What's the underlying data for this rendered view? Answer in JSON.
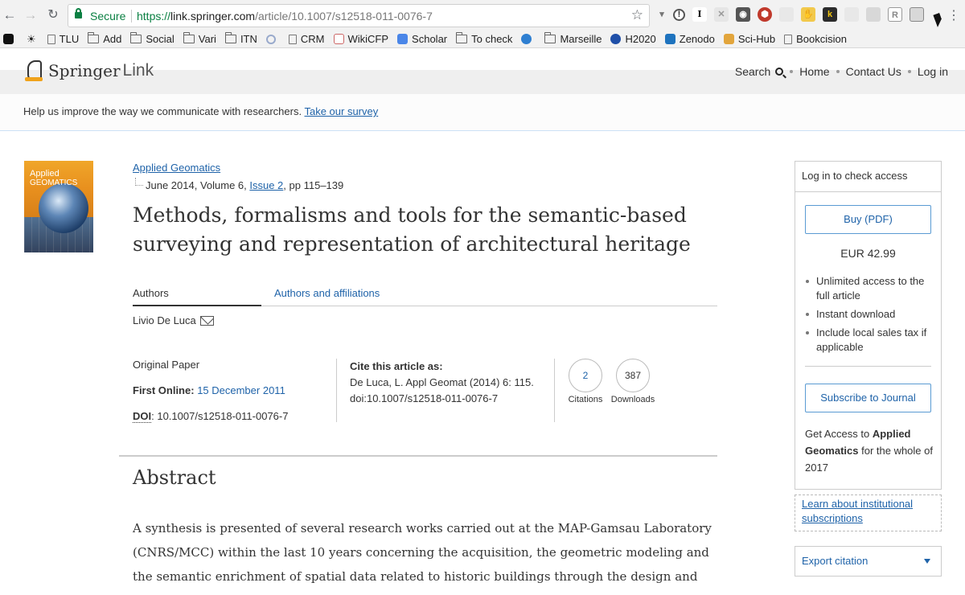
{
  "browser": {
    "secure_label": "Secure",
    "url_scheme": "https://",
    "url_host": "link.springer.com",
    "url_path": "/article/10.1007/s12518-011-0076-7",
    "bookmarks": [
      {
        "label": "TLU",
        "type": "page"
      },
      {
        "label": "Add",
        "type": "folder"
      },
      {
        "label": "Social",
        "type": "folder"
      },
      {
        "label": "Vari",
        "type": "folder"
      },
      {
        "label": "ITN",
        "type": "folder"
      },
      {
        "label": "",
        "type": "loading"
      },
      {
        "label": "CRM",
        "type": "page"
      },
      {
        "label": "WikiCFP",
        "type": "favicon"
      },
      {
        "label": "Scholar",
        "type": "favicon"
      },
      {
        "label": "To check",
        "type": "folder"
      },
      {
        "label": "",
        "type": "favicon"
      },
      {
        "label": "Marseille",
        "type": "folder"
      },
      {
        "label": "H2020",
        "type": "favicon"
      },
      {
        "label": "Zenodo",
        "type": "favicon"
      },
      {
        "label": "Sci-Hub",
        "type": "favicon"
      },
      {
        "label": "Bookcision",
        "type": "page"
      }
    ]
  },
  "header": {
    "logo_springer": "Springer",
    "logo_link": "Link",
    "search_label": "Search",
    "home_label": "Home",
    "contact_label": "Contact Us",
    "login_label": "Log in"
  },
  "survey": {
    "text": "Help us improve the way we communicate with researchers.",
    "link_label": "Take our survey"
  },
  "cover": {
    "title_line1": "Applied",
    "title_line2": "GEOMATICS"
  },
  "article": {
    "journal": "Applied Geomatics",
    "issue_prefix": "June 2014, Volume 6, ",
    "issue_link": "Issue 2",
    "issue_suffix": ", pp 115–139",
    "title": "Methods, formalisms and tools for the semantic-based surveying and representation of architectural heritage",
    "tab_authors": "Authors",
    "tab_affiliations": "Authors and affiliations",
    "author": "Livio De Luca",
    "paper_type": "Original Paper",
    "first_online_label": "First Online:",
    "first_online_date": "15 December 2011",
    "doi_label": "DOI",
    "doi_value": ": 10.1007/s12518-011-0076-7",
    "cite_heading": "Cite this article as:",
    "cite_text": "De Luca, L. Appl Geomat (2014) 6: 115. doi:10.1007/s12518-011-0076-7",
    "citations_count": "2",
    "citations_label": "Citations",
    "downloads_count": "387",
    "downloads_label": "Downloads",
    "abstract_heading": "Abstract",
    "abstract_text": "A synthesis is presented of several research works carried out at the MAP-Gamsau Laboratory (CNRS/MCC) within the last 10 years concerning the acquisition, the geometric modeling and the semantic enrichment of spatial data related to historic buildings through the design and the"
  },
  "sidebar": {
    "access_heading": "Log in to check access",
    "buy_label": "Buy (PDF)",
    "price": "EUR 42.99",
    "benefits": [
      "Unlimited access to the full article",
      "Instant download",
      "Include local sales tax if applicable"
    ],
    "subscribe_label": "Subscribe to Journal",
    "get_access_prefix": "Get Access to ",
    "get_access_journal": "Applied Geomatics",
    "get_access_suffix": " for the whole of 2017",
    "institutional_link": "Learn about institutional subscriptions",
    "export_label": "Export citation"
  },
  "colors": {
    "link": "#1f63a9",
    "secure": "#0b8043",
    "accent": "#f0a21b"
  }
}
